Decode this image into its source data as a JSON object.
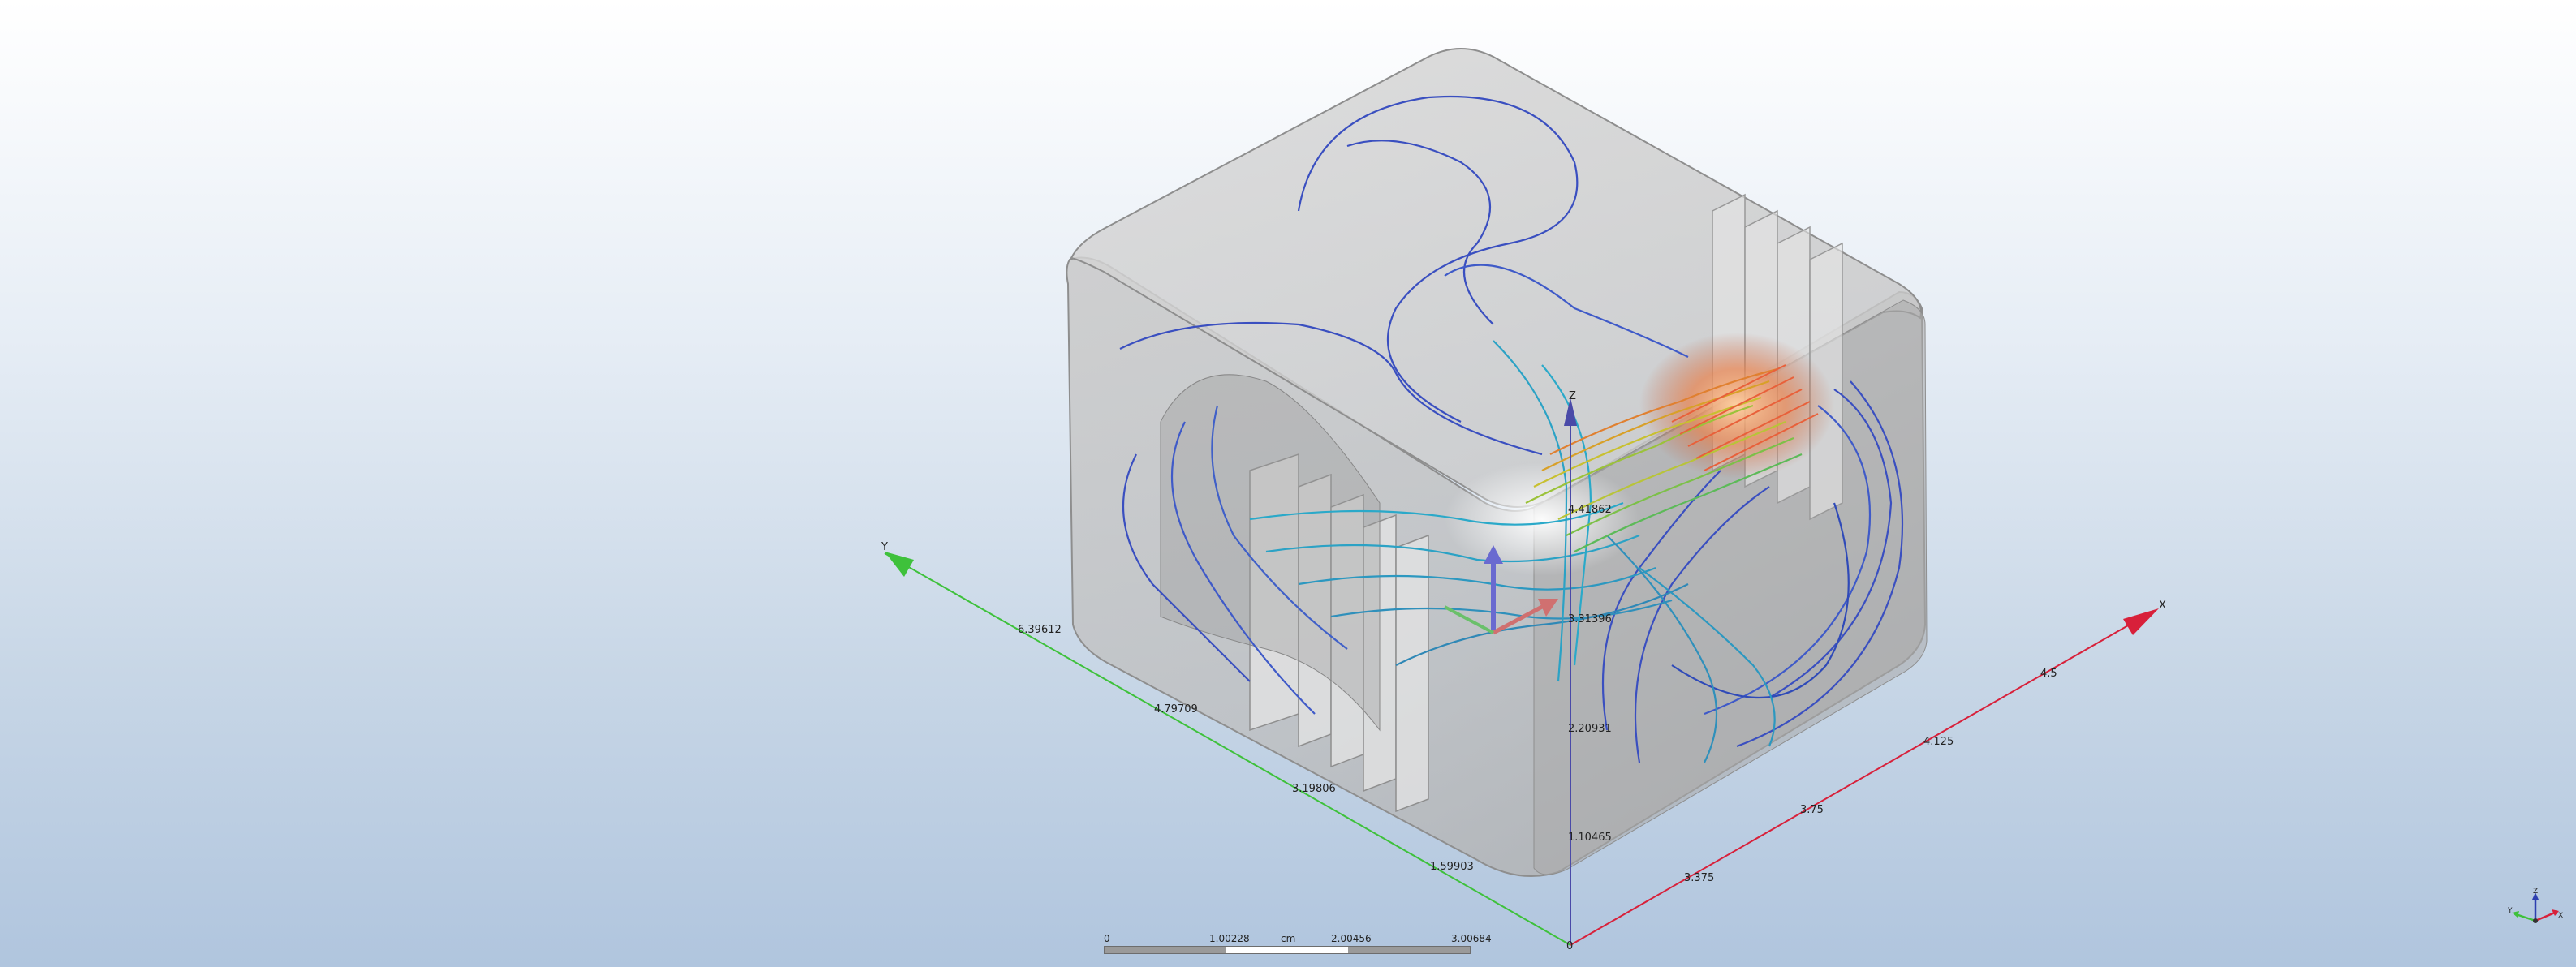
{
  "axes": {
    "x": {
      "name": "X",
      "color": "#d8203a",
      "ticks": [
        "3.375",
        "3.75",
        "4.125",
        "4.5"
      ]
    },
    "y": {
      "name": "Y",
      "color": "#3ec13b",
      "ticks": [
        "6.39612",
        "4.79709",
        "3.19806",
        "1.59903"
      ]
    },
    "z": {
      "name": "Z",
      "color": "#4a4aa8",
      "ticks": [
        "4.41862",
        "3.31396",
        "2.20931",
        "1.10465"
      ]
    },
    "origin_label": "0"
  },
  "scale_bar": {
    "labels": [
      "0",
      "1.00228",
      "cm",
      "2.00456",
      "3.00684"
    ]
  },
  "triad": {
    "x_label": "X",
    "y_label": "Y",
    "z_label": "Z"
  },
  "colors": {
    "streamline_cool": "#3a4fc0",
    "streamline_mid": "#2aa9c9",
    "streamline_warm": "#d8a028",
    "streamline_hot": "#e8603a",
    "body": "#b9b9b9"
  }
}
